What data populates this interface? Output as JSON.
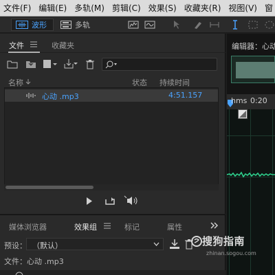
{
  "menu": [
    "文件(F)",
    "编辑(E)",
    "多轨(M)",
    "剪辑(C)",
    "效果(S)",
    "收藏夹(R)",
    "视图(V)",
    "窗"
  ],
  "toolbar": {
    "waveform_label": "波形",
    "multitrack_label": "多轨"
  },
  "files_panel": {
    "tab_files": "文件",
    "tab_favorites": "收藏夹",
    "col_name": "名称",
    "col_status": "状态",
    "col_duration": "持续时间",
    "rows": [
      {
        "name": "心动 .mp3",
        "duration": "4:51.157"
      }
    ]
  },
  "bottom_panel": {
    "tab_media_browser": "媒体浏览器",
    "tab_effects_rack": "效果组",
    "tab_markers": "标记",
    "tab_properties": "属性",
    "preset_label": "预设：",
    "preset_value": "（默认）",
    "file_line": "文件：心动 .mp3"
  },
  "editor": {
    "title": "编辑器：心动",
    "ruler_unit": "hms",
    "ruler_tick": "0:20"
  },
  "watermark": {
    "text": "搜狗指南",
    "sub": "zhinan.sogou.com"
  },
  "colors": {
    "accent": "#4aa3ff",
    "wave": "#2ecf8c"
  }
}
